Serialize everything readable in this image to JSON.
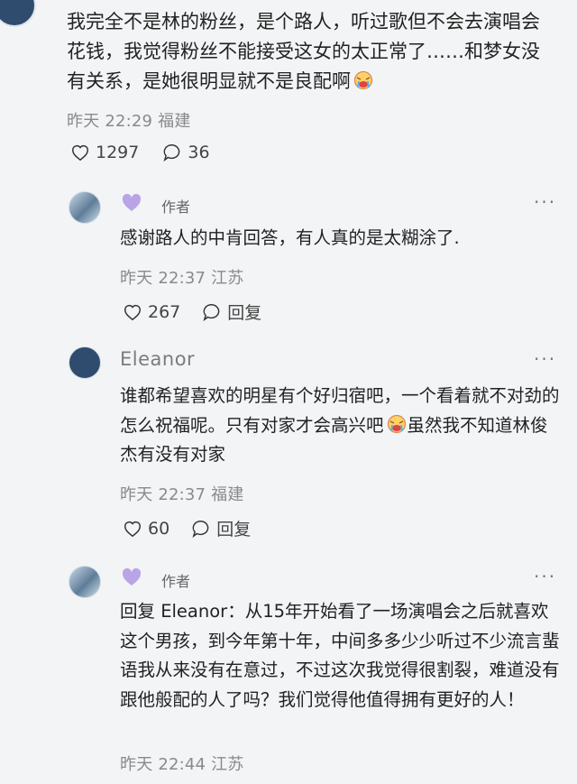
{
  "top_comment": {
    "text": "我完全不是林的粉丝，是个路人，听过歌但不会去演唱会花钱，我觉得粉丝不能接受这女的太正常了……和梦女没有关系，是她很明显就不是良配啊",
    "time": "昨天 22:29 福建",
    "likes": "1297",
    "comments": "36"
  },
  "replies": [
    {
      "author_tag": "作者",
      "text": "感谢路人的中肯回答，有人真的是太糊涂了.",
      "time": "昨天 22:37 江苏",
      "likes": "267",
      "reply_label": "回复"
    },
    {
      "username": "Eleanor",
      "text_a": "谁都希望喜欢的明星有个好归宿吧，一个看着就不对劲的怎么祝福呢。只有对家才会高兴吧",
      "text_b": "虽然我不知道林俊杰有没有对家",
      "time": "昨天 22:37 福建",
      "likes": "60",
      "reply_label": "回复"
    },
    {
      "author_tag": "作者",
      "text": "回复 Eleanor：从15年开始看了一场演唱会之后就喜欢这个男孩，到今年第十年，中间多多少少听过不少流言蜚语我从来没有在意过，不过这次我觉得很割裂，难道没有跟他般配的人了吗？我们觉得他值得拥有更好的人！",
      "time": "昨天 22:44 江苏"
    }
  ],
  "more_label": "···",
  "colors": {
    "background": "#f3f4f6",
    "heart_badge": "#b9a4e6",
    "meta_text": "#8a8a8a"
  },
  "icons": [
    "heart-outline-icon",
    "comment-bubble-icon",
    "emoji-icon",
    "purple-heart-icon",
    "more-icon"
  ]
}
